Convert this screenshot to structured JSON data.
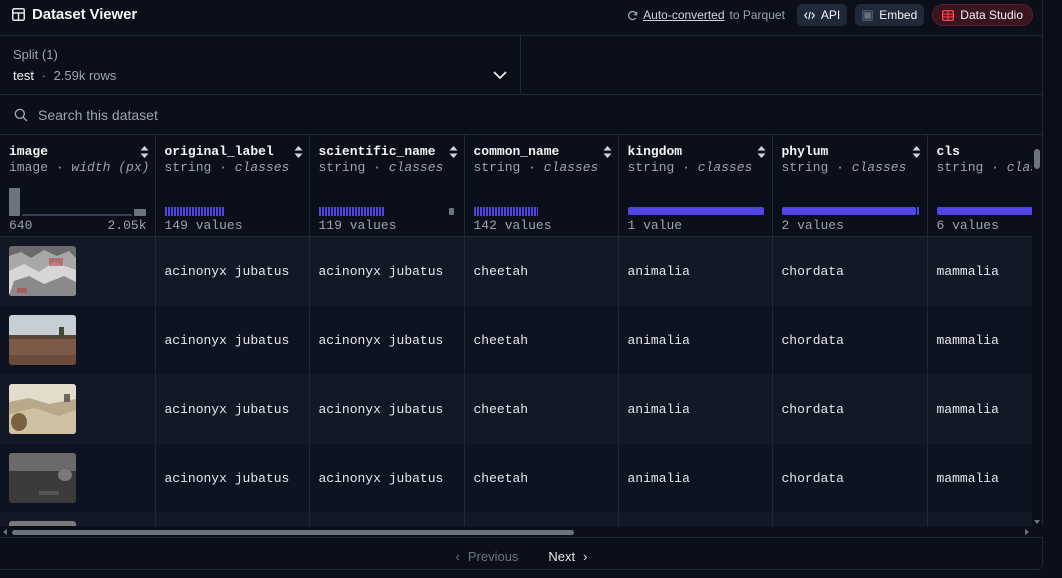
{
  "header": {
    "title": "Dataset Viewer",
    "auto_converted_link": "Auto-converted",
    "auto_converted_suffix": "to Parquet",
    "api_label": "API",
    "embed_label": "Embed",
    "studio_label": "Data Studio"
  },
  "split": {
    "label": "Split (1)",
    "name": "test",
    "separator": "·",
    "rows": "2.59k rows"
  },
  "search": {
    "placeholder": "Search this dataset"
  },
  "columns": [
    {
      "name": "image",
      "type": "image",
      "sep": " · ",
      "subtype": "width (px)",
      "min": "640",
      "max": "2.05k"
    },
    {
      "name": "original_label",
      "type": "string",
      "sep": " · ",
      "subtype": "classes",
      "stat": "149 values"
    },
    {
      "name": "scientific_name",
      "type": "string",
      "sep": " · ",
      "subtype": "classes",
      "stat": "119 values"
    },
    {
      "name": "common_name",
      "type": "string",
      "sep": " · ",
      "subtype": "classes",
      "stat": "142 values"
    },
    {
      "name": "kingdom",
      "type": "string",
      "sep": " · ",
      "subtype": "classes",
      "stat": "1 value"
    },
    {
      "name": "phylum",
      "type": "string",
      "sep": " · ",
      "subtype": "classes",
      "stat": "2 values"
    },
    {
      "name": "cls",
      "type": "string",
      "sep": " · ",
      "subtype": "classes",
      "stat": "6 values"
    }
  ],
  "rows": [
    {
      "original_label": "acinonyx jubatus",
      "scientific_name": "acinonyx jubatus",
      "common_name": "cheetah",
      "kingdom": "animalia",
      "phylum": "chordata",
      "cls": "mammalia"
    },
    {
      "original_label": "acinonyx jubatus",
      "scientific_name": "acinonyx jubatus",
      "common_name": "cheetah",
      "kingdom": "animalia",
      "phylum": "chordata",
      "cls": "mammalia"
    },
    {
      "original_label": "acinonyx jubatus",
      "scientific_name": "acinonyx jubatus",
      "common_name": "cheetah",
      "kingdom": "animalia",
      "phylum": "chordata",
      "cls": "mammalia"
    },
    {
      "original_label": "acinonyx jubatus",
      "scientific_name": "acinonyx jubatus",
      "common_name": "cheetah",
      "kingdom": "animalia",
      "phylum": "chordata",
      "cls": "mammalia"
    },
    {
      "original_label": "",
      "scientific_name": "",
      "common_name": "",
      "kingdom": "",
      "phylum": "",
      "cls": ""
    }
  ],
  "pagination": {
    "previous_label": "Previous",
    "next_label": "Next",
    "prev_icon": "‹",
    "next_icon": "›"
  },
  "colors": {
    "background": "#0b0f19",
    "accent_bar": "#4f46e5",
    "studio_red": "#ef4444"
  },
  "icons": {
    "title": "grid-icon",
    "auto_convert": "refresh-icon",
    "api": "code-icon",
    "embed": "embed-icon",
    "studio": "table-icon",
    "split": "chevron-down-icon",
    "search": "search-icon",
    "sort": "sort-icon"
  }
}
